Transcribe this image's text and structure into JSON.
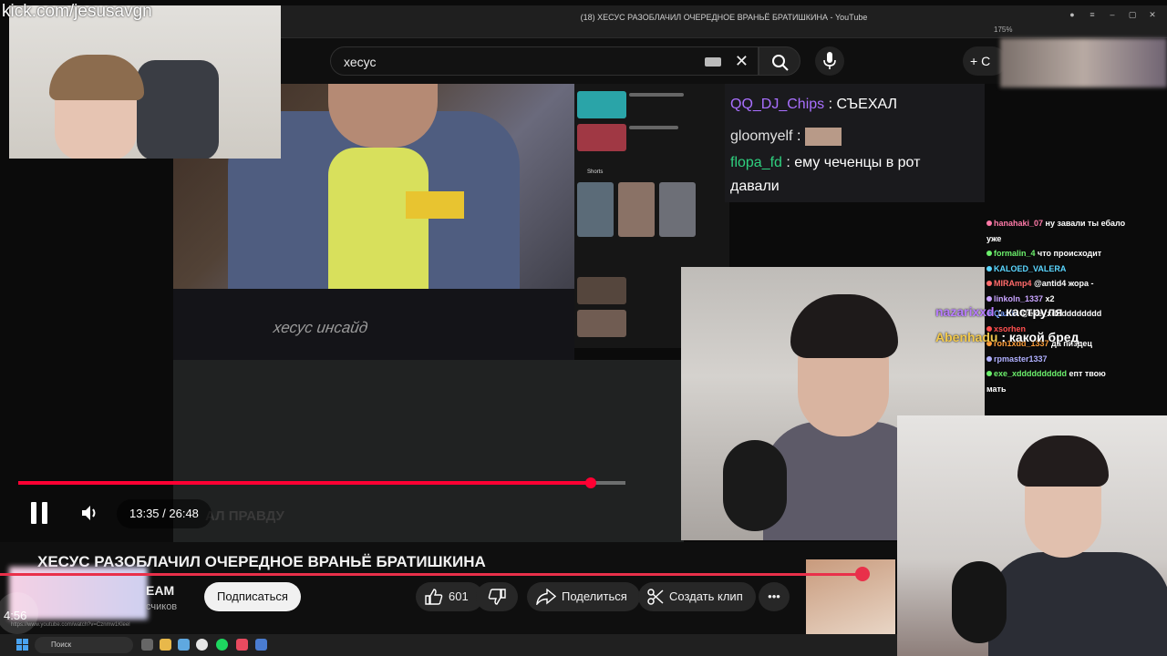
{
  "stream": {
    "kick_url": "kick.com/jesusavgn",
    "vod_time": "4:56"
  },
  "browser": {
    "tab_title": "(18) ХЕСУС РАЗОБЛАЧИЛ ОЧЕРЕДНОЕ ВРАНЬЁ БРАТИШКИНА - YouTube",
    "zoom": "175%"
  },
  "youtube": {
    "search_value": "хесус",
    "create_label": "+ С",
    "watermark": "хесус инсайд",
    "faded_caption": "АЛ ПРАВДУ",
    "shorts_label": "Shorts",
    "url_hint": "https://www.youtube.com/watch?v=Cznmw1Kleel",
    "player": {
      "current_time": "13:35",
      "duration": "26:48",
      "time_display": "13:35 / 26:48",
      "progress_fraction": 0.943,
      "progress_track_fraction": 0.943
    },
    "video_title": "ХЕСУС РАЗОБЛАЧИЛ ОЧЕРЕДНОЕ ВРАНЬЁ БРАТИШКИНА",
    "channel_name": "EAM",
    "subscribers": "счиков",
    "subscribe_label": "Подписаться",
    "like_count": "601",
    "share_label": "Поделиться",
    "clip_label": "Создать клип",
    "more_label": "•••"
  },
  "chat_top": [
    {
      "user": "QQ_DJ_Chips",
      "message": ": СЪЕХАЛ",
      "color": "#a970ff"
    },
    {
      "user": "gloomyelf",
      "message": ":",
      "color": "#e0e0e0"
    },
    {
      "user": "flopa_fd",
      "message": ": ему чеченцы в рот",
      "color": "#2fd07f"
    },
    {
      "user": "",
      "message": "давали",
      "color": "#ffffff"
    }
  ],
  "chat_right": [
    {
      "user": "hanahaki_07",
      "message": "ну завали ты ебало",
      "color": "#ff7aa8"
    },
    {
      "user": "",
      "message": "уже",
      "color": "#fff"
    },
    {
      "user": "formalin_4",
      "message": "что происходит",
      "color": "#6cf06c"
    },
    {
      "user": "KALOED_VALERA",
      "message": "",
      "color": "#5ad6ff"
    },
    {
      "user": "MIRAmp4",
      "message": "@antid4 жора -",
      "color": "#ff6a6a"
    },
    {
      "user": "linkoln_1337",
      "message": "x2",
      "color": "#c9a4ff"
    },
    {
      "user": "Qaztix",
      "message": "@exe_xdddddddddd",
      "color": "#7aa2ff"
    },
    {
      "user": "xsorhen",
      "message": "",
      "color": "#ff4f4f"
    },
    {
      "user": "ron1xdd_1337",
      "message": "да пиздец",
      "color": "#ff9f3a"
    },
    {
      "user": "rpmaster1337",
      "message": "",
      "color": "#b0b0ff"
    },
    {
      "user": "exe_xdddddddddd",
      "message": "епт твою",
      "color": "#6cf06c"
    },
    {
      "user": "",
      "message": "мать",
      "color": "#fff"
    }
  ],
  "chat_overlay": [
    {
      "user": "nazarixxd",
      "message": ": каструля",
      "color": "#b77cff"
    },
    {
      "user": "Abenhadu",
      "message": ": какой бред",
      "color": "#f2c94c"
    }
  ],
  "taskbar": {
    "search_placeholder": "Поиск"
  },
  "colors": {
    "yt_red": "#ff0033",
    "overlay_red": "#e9304a",
    "background": "#0f0f0f"
  }
}
